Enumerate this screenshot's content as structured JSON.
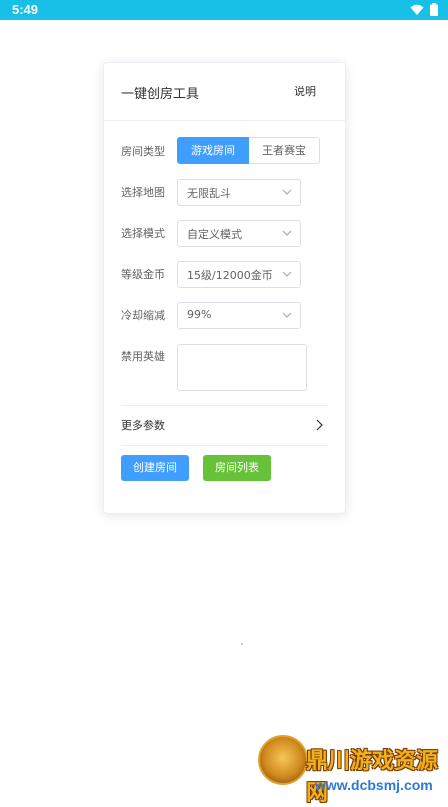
{
  "status_bar": {
    "time": "5:49",
    "icons": [
      "wifi-icon",
      "battery-icon"
    ],
    "color": "#18bfe7"
  },
  "card": {
    "title": "一键创房工具",
    "help": "说明",
    "form": {
      "room_type": {
        "label": "房间类型",
        "options": [
          "游戏房间",
          "王者赛宝"
        ],
        "selected": "游戏房间"
      },
      "map": {
        "label": "选择地图",
        "value": "无限乱斗"
      },
      "mode": {
        "label": "选择模式",
        "value": "自定义模式"
      },
      "gold": {
        "label": "等级金币",
        "value": "15级/12000金币"
      },
      "cooldown": {
        "label": "冷却缩减",
        "value": "99%"
      },
      "ban_heroes": {
        "label": "禁用英雄",
        "value": ""
      }
    },
    "more_params": "更多参数",
    "buttons": {
      "create": "创建房间",
      "list": "房间列表"
    }
  },
  "colors": {
    "primary": "#409eff",
    "success": "#67c23a",
    "border": "#dcdfe6"
  },
  "watermark": {
    "title": "鼎川游戏资源网",
    "url": "www.dcbsmj.com"
  }
}
